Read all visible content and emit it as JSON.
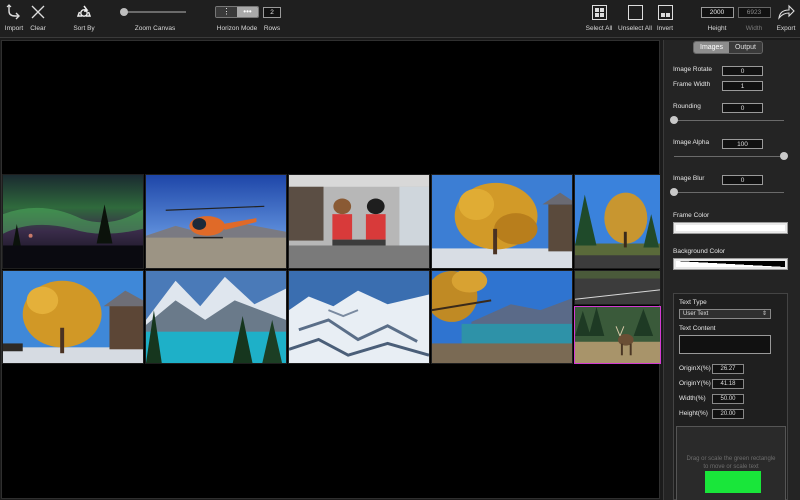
{
  "toolbar": {
    "import_label": "Import",
    "clear_label": "Clear",
    "sort_by_label": "Sort By",
    "zoom_canvas_label": "Zoom Canvas",
    "zoom_level": 0.0,
    "horizon_mode_label": "Horizon Mode",
    "horizon_mode_options": [
      "⋮",
      "•••"
    ],
    "horizon_mode_selected": 1,
    "rows_label": "Rows",
    "rows_value": "2",
    "select_all_label": "Select All",
    "unselect_all_label": "Unselect All",
    "invert_label": "Invert",
    "height_label": "Height",
    "height_value": "2000",
    "width_label": "Width",
    "width_value": "6923",
    "export_label": "Export"
  },
  "icons": {
    "import": "import-arrow-icon",
    "clear": "x-icon",
    "sort_by": "recycle-icon",
    "select_all": "grid-select-all-icon",
    "unselect_all": "empty-square-icon",
    "invert": "invert-grid-icon",
    "export": "share-arrow-icon"
  },
  "canvas": {
    "images": [
      {
        "name": "aurora-lake",
        "row": 1
      },
      {
        "name": "helicopter",
        "row": 1
      },
      {
        "name": "moose-statues",
        "row": 1
      },
      {
        "name": "golden-larch-tree",
        "row": 1
      },
      {
        "name": "autumn-tree-road",
        "row": 1
      },
      {
        "name": "golden-tree-lodge",
        "row": 2
      },
      {
        "name": "turquoise-lake",
        "row": 2
      },
      {
        "name": "snowy-mountains-aerial",
        "row": 2
      },
      {
        "name": "lake-shore-autumn",
        "row": 2
      },
      {
        "name": "elk",
        "row": 2,
        "selected": true
      }
    ],
    "selection_color": "#d23ad2"
  },
  "panel": {
    "tabs": [
      {
        "label": "Images",
        "active": true
      },
      {
        "label": "Output",
        "active": false
      }
    ],
    "image_rotate_label": "Image Rotate",
    "image_rotate_value": "0",
    "frame_width_label": "Frame Width",
    "frame_width_value": "1",
    "rounding_label": "Rounding",
    "rounding_value": "0",
    "rounding_level": 0.0,
    "image_alpha_label": "Image Alpha",
    "image_alpha_value": "100",
    "image_alpha_level": 1.0,
    "image_blur_label": "Image Blur",
    "image_blur_value": "0",
    "image_blur_level": 0.0,
    "frame_color_label": "Frame Color",
    "frame_color": "#ffffff",
    "background_color_label": "Background Color",
    "text": {
      "type_label": "Text Type",
      "type_value": "User Text",
      "content_label": "Text Content",
      "content_value": "",
      "origin_x_label": "OriginX(%)",
      "origin_x_value": "26.27",
      "origin_y_label": "OriginY(%)",
      "origin_y_value": "41.18",
      "width_label": "Width(%)",
      "width_value": "50.00",
      "height_label": "Height(%)",
      "height_value": "20.00",
      "preview_hint": "Drag or scale the green rectangle to move or scale text",
      "preview_rect_color": "#19e63a"
    }
  }
}
